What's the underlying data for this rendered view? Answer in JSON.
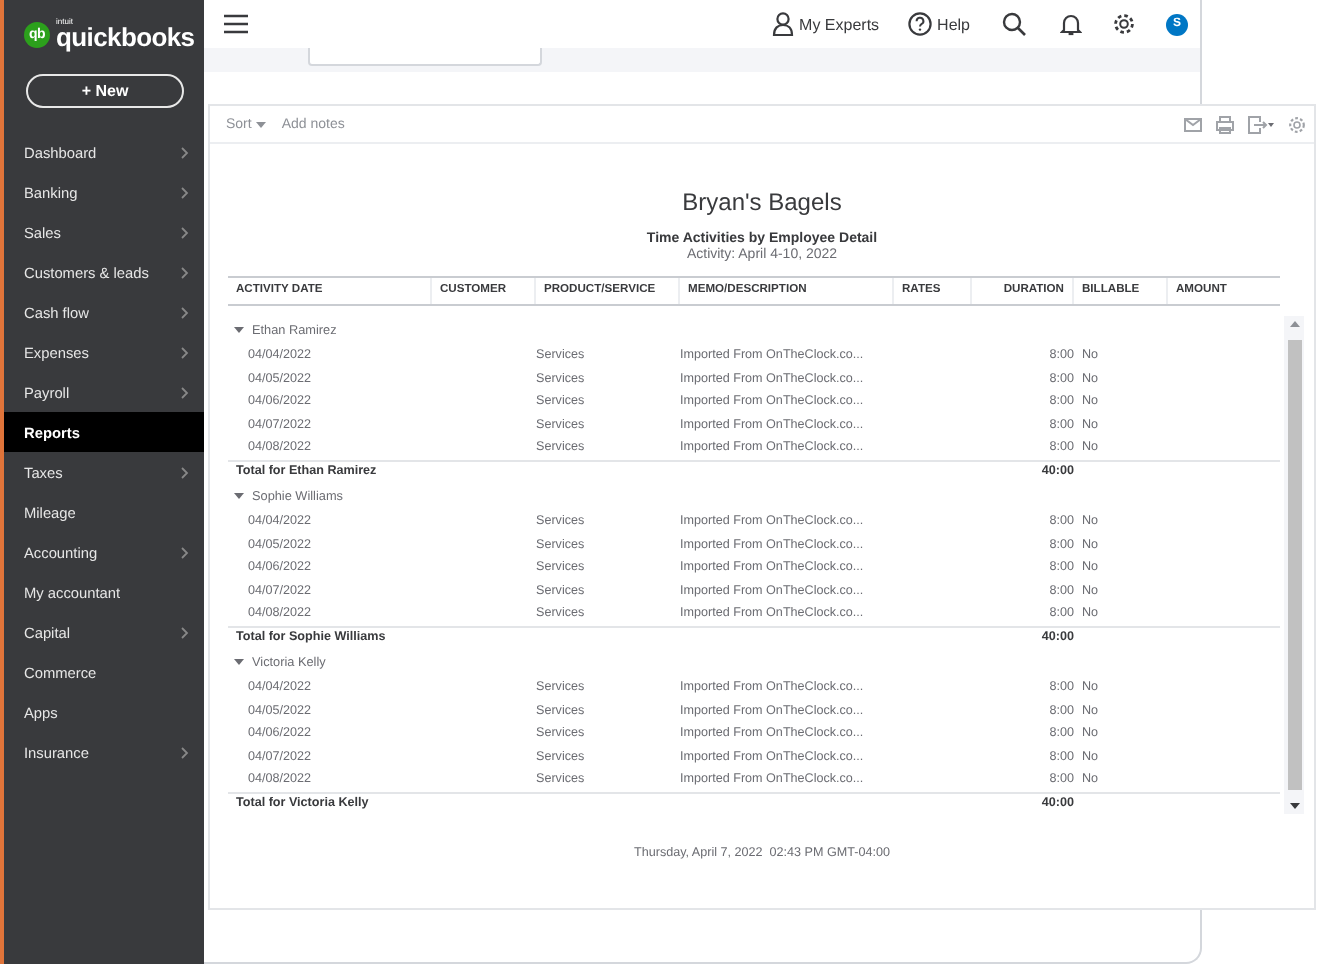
{
  "sidebar": {
    "logo": {
      "mark": "qb",
      "small": "intuit",
      "brand": "quickbooks"
    },
    "new_button": "+ New",
    "items": [
      {
        "label": "Dashboard",
        "has_submenu": true,
        "selected": false
      },
      {
        "label": "Banking",
        "has_submenu": true,
        "selected": false
      },
      {
        "label": "Sales",
        "has_submenu": true,
        "selected": false
      },
      {
        "label": "Customers & leads",
        "has_submenu": true,
        "selected": false
      },
      {
        "label": "Cash flow",
        "has_submenu": true,
        "selected": false
      },
      {
        "label": "Expenses",
        "has_submenu": true,
        "selected": false
      },
      {
        "label": "Payroll",
        "has_submenu": true,
        "selected": false
      },
      {
        "label": "Reports",
        "has_submenu": false,
        "selected": true
      },
      {
        "label": "Taxes",
        "has_submenu": true,
        "selected": false
      },
      {
        "label": "Mileage",
        "has_submenu": false,
        "selected": false
      },
      {
        "label": "Accounting",
        "has_submenu": true,
        "selected": false
      },
      {
        "label": "My accountant",
        "has_submenu": false,
        "selected": false
      },
      {
        "label": "Capital",
        "has_submenu": true,
        "selected": false
      },
      {
        "label": "Commerce",
        "has_submenu": false,
        "selected": false
      },
      {
        "label": "Apps",
        "has_submenu": false,
        "selected": false
      },
      {
        "label": "Insurance",
        "has_submenu": true,
        "selected": false
      }
    ]
  },
  "topbar": {
    "my_experts": "My Experts",
    "help": "Help",
    "avatar": "S"
  },
  "report": {
    "toolbar": {
      "sort": "Sort",
      "add_notes": "Add notes"
    },
    "company": "Bryan's Bagels",
    "title": "Time Activities by Employee Detail",
    "period": "Activity: April 4-10, 2022",
    "columns": [
      "ACTIVITY DATE",
      "CUSTOMER",
      "PRODUCT/SERVICE",
      "MEMO/DESCRIPTION",
      "RATES",
      "DURATION",
      "BILLABLE",
      "AMOUNT"
    ],
    "groups": [
      {
        "name": "Ethan Ramirez",
        "expanded": true,
        "rows": [
          {
            "activity_date": "04/04/2022",
            "product_service": "Services",
            "memo": "Imported From OnTheClock.co...",
            "duration": "8:00",
            "billable": "No"
          },
          {
            "activity_date": "04/05/2022",
            "product_service": "Services",
            "memo": "Imported From OnTheClock.co...",
            "duration": "8:00",
            "billable": "No"
          },
          {
            "activity_date": "04/06/2022",
            "product_service": "Services",
            "memo": "Imported From OnTheClock.co...",
            "duration": "8:00",
            "billable": "No"
          },
          {
            "activity_date": "04/07/2022",
            "product_service": "Services",
            "memo": "Imported From OnTheClock.co...",
            "duration": "8:00",
            "billable": "No"
          },
          {
            "activity_date": "04/08/2022",
            "product_service": "Services",
            "memo": "Imported From OnTheClock.co...",
            "duration": "8:00",
            "billable": "No"
          }
        ],
        "total_label": "Total for Ethan Ramirez",
        "total_duration": "40:00"
      },
      {
        "name": "Sophie Williams",
        "expanded": true,
        "rows": [
          {
            "activity_date": "04/04/2022",
            "product_service": "Services",
            "memo": "Imported From OnTheClock.co...",
            "duration": "8:00",
            "billable": "No"
          },
          {
            "activity_date": "04/05/2022",
            "product_service": "Services",
            "memo": "Imported From OnTheClock.co...",
            "duration": "8:00",
            "billable": "No"
          },
          {
            "activity_date": "04/06/2022",
            "product_service": "Services",
            "memo": "Imported From OnTheClock.co...",
            "duration": "8:00",
            "billable": "No"
          },
          {
            "activity_date": "04/07/2022",
            "product_service": "Services",
            "memo": "Imported From OnTheClock.co...",
            "duration": "8:00",
            "billable": "No"
          },
          {
            "activity_date": "04/08/2022",
            "product_service": "Services",
            "memo": "Imported From OnTheClock.co...",
            "duration": "8:00",
            "billable": "No"
          }
        ],
        "total_label": "Total for Sophie Williams",
        "total_duration": "40:00"
      },
      {
        "name": "Victoria Kelly",
        "expanded": true,
        "rows": [
          {
            "activity_date": "04/04/2022",
            "product_service": "Services",
            "memo": "Imported From OnTheClock.co...",
            "duration": "8:00",
            "billable": "No"
          },
          {
            "activity_date": "04/05/2022",
            "product_service": "Services",
            "memo": "Imported From OnTheClock.co...",
            "duration": "8:00",
            "billable": "No"
          },
          {
            "activity_date": "04/06/2022",
            "product_service": "Services",
            "memo": "Imported From OnTheClock.co...",
            "duration": "8:00",
            "billable": "No"
          },
          {
            "activity_date": "04/07/2022",
            "product_service": "Services",
            "memo": "Imported From OnTheClock.co...",
            "duration": "8:00",
            "billable": "No"
          },
          {
            "activity_date": "04/08/2022",
            "product_service": "Services",
            "memo": "Imported From OnTheClock.co...",
            "duration": "8:00",
            "billable": "No"
          }
        ],
        "total_label": "Total for Victoria Kelly",
        "total_duration": "40:00"
      }
    ],
    "footer": "Thursday, April 7, 2022  02:43 PM GMT-04:00"
  }
}
